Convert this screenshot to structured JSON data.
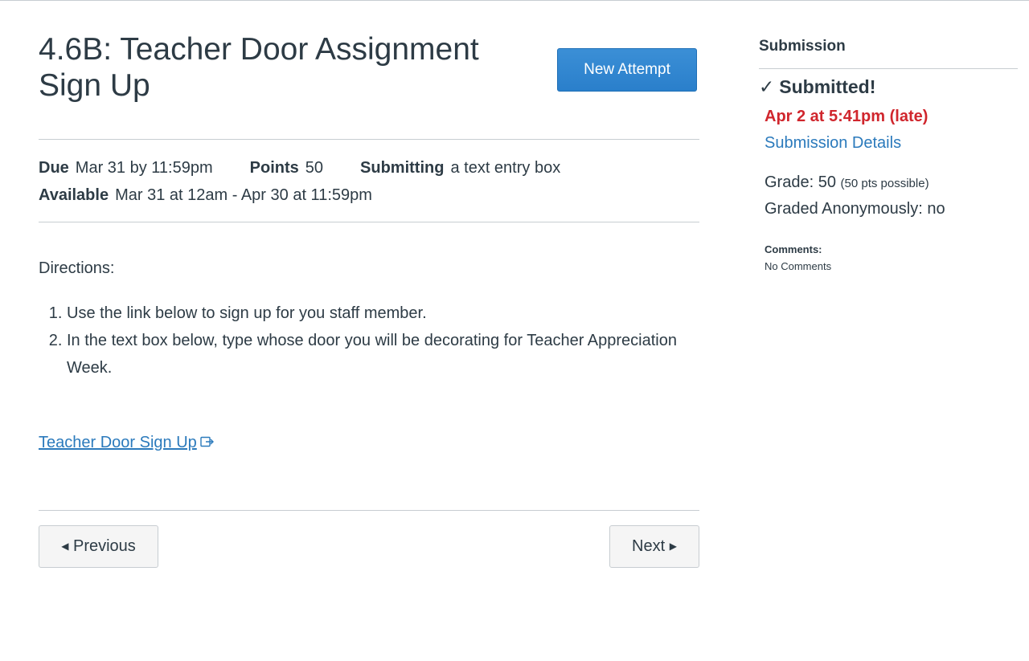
{
  "assignment": {
    "title": "4.6B: Teacher Door Assignment Sign Up",
    "new_attempt_label": "New Attempt"
  },
  "details": {
    "due_label": "Due",
    "due_value": "Mar 31 by 11:59pm",
    "points_label": "Points",
    "points_value": "50",
    "submitting_label": "Submitting",
    "submitting_value": "a text entry box",
    "available_label": "Available",
    "available_value": "Mar 31 at 12am - Apr 30 at 11:59pm"
  },
  "content": {
    "directions_heading": "Directions:",
    "steps": [
      "Use the link below to sign up for you staff member.",
      "In the text box below, type whose door you will be decorating for Teacher Appreciation Week."
    ],
    "link_text": "Teacher Door Sign Up",
    "link_icon": "external-link-icon"
  },
  "pager": {
    "previous_label": "Previous",
    "next_label": "Next"
  },
  "sidebar": {
    "heading": "Submission",
    "status": "Submitted!",
    "status_icon": "checkmark-icon",
    "submitted_at": "Apr 2 at 5:41pm (late)",
    "details_link": "Submission Details",
    "grade_label": "Grade: 50",
    "grade_possible": "(50 pts possible)",
    "graded_anonymously": "Graded Anonymously: no",
    "comments_label": "Comments:",
    "comments_value": "No Comments"
  },
  "colors": {
    "link": "#2b7abc",
    "late": "#d0262d",
    "primary_button": "#2a7fcb",
    "divider": "#c7cdd1",
    "text": "#2d3b45"
  }
}
